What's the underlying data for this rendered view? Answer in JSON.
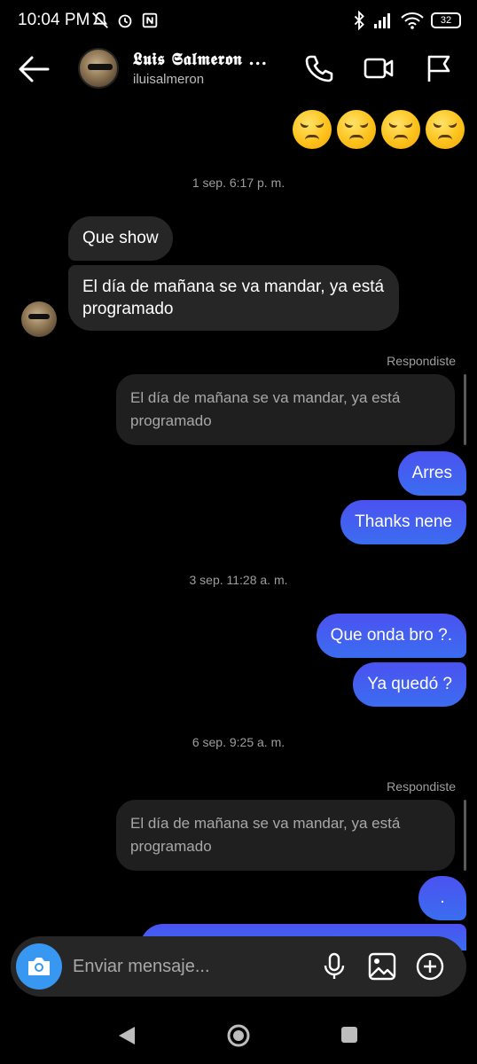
{
  "status": {
    "time": "10:04 PM",
    "battery": "32"
  },
  "header": {
    "name": "𝕷𝖚𝖎𝖘 𝕾𝖆𝖑𝖒𝖊𝖗𝖔𝖓 ...",
    "handle": "iluisalmeron",
    "icons": [
      "back-arrow-icon",
      "phone-icon",
      "video-camera-icon",
      "flag-icon"
    ]
  },
  "emoji_message": {
    "emoji": "disappointed-face",
    "count": 4
  },
  "timestamps": [
    "1 sep. 6:17 p. m.",
    "3 sep. 11:28 a. m.",
    "6 sep. 9:25 a. m."
  ],
  "messages": {
    "incoming_1": "Que show",
    "incoming_2": "El día de mañana se va mandar, ya está programado",
    "reply_label_1": "Respondiste",
    "reply_quote_1": "El día de mañana se va mandar, ya está programado",
    "outgoing_1": "Arres",
    "outgoing_2": "Thanks nene",
    "outgoing_3": "Que onda bro ?.",
    "outgoing_4": "Ya quedó ?",
    "reply_label_2": "Respondiste",
    "reply_quote_2": "El día de mañana se va mandar, ya está programado",
    "outgoing_5": "."
  },
  "composer": {
    "placeholder": "Enviar mensaje...",
    "icons": [
      "camera-icon",
      "microphone-icon",
      "gallery-icon",
      "plus-icon"
    ]
  },
  "colors": {
    "background": "#000000",
    "incoming_bubble": "#262626",
    "outgoing_bubble": "#4b52f0",
    "camera_button": "#3897f0"
  }
}
